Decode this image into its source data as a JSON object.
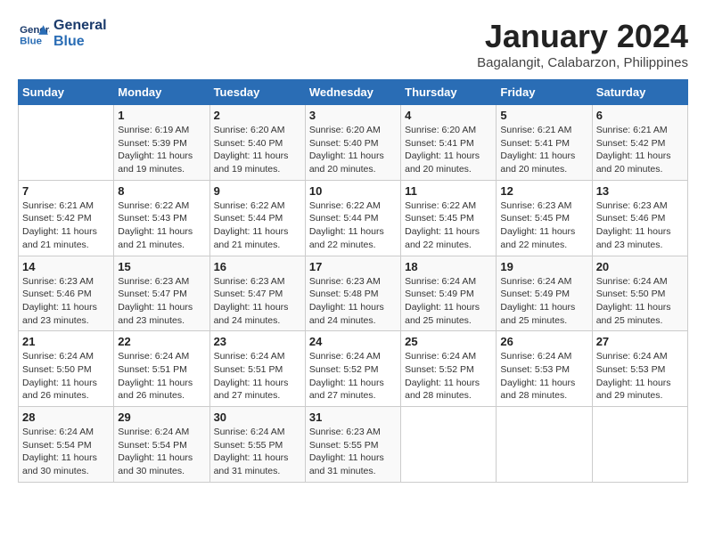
{
  "logo": {
    "line1": "General",
    "line2": "Blue"
  },
  "title": "January 2024",
  "subtitle": "Bagalangit, Calabarzon, Philippines",
  "header_days": [
    "Sunday",
    "Monday",
    "Tuesday",
    "Wednesday",
    "Thursday",
    "Friday",
    "Saturday"
  ],
  "weeks": [
    [
      {
        "day": "",
        "info": ""
      },
      {
        "day": "1",
        "info": "Sunrise: 6:19 AM\nSunset: 5:39 PM\nDaylight: 11 hours\nand 19 minutes."
      },
      {
        "day": "2",
        "info": "Sunrise: 6:20 AM\nSunset: 5:40 PM\nDaylight: 11 hours\nand 19 minutes."
      },
      {
        "day": "3",
        "info": "Sunrise: 6:20 AM\nSunset: 5:40 PM\nDaylight: 11 hours\nand 20 minutes."
      },
      {
        "day": "4",
        "info": "Sunrise: 6:20 AM\nSunset: 5:41 PM\nDaylight: 11 hours\nand 20 minutes."
      },
      {
        "day": "5",
        "info": "Sunrise: 6:21 AM\nSunset: 5:41 PM\nDaylight: 11 hours\nand 20 minutes."
      },
      {
        "day": "6",
        "info": "Sunrise: 6:21 AM\nSunset: 5:42 PM\nDaylight: 11 hours\nand 20 minutes."
      }
    ],
    [
      {
        "day": "7",
        "info": "Sunrise: 6:21 AM\nSunset: 5:42 PM\nDaylight: 11 hours\nand 21 minutes."
      },
      {
        "day": "8",
        "info": "Sunrise: 6:22 AM\nSunset: 5:43 PM\nDaylight: 11 hours\nand 21 minutes."
      },
      {
        "day": "9",
        "info": "Sunrise: 6:22 AM\nSunset: 5:44 PM\nDaylight: 11 hours\nand 21 minutes."
      },
      {
        "day": "10",
        "info": "Sunrise: 6:22 AM\nSunset: 5:44 PM\nDaylight: 11 hours\nand 22 minutes."
      },
      {
        "day": "11",
        "info": "Sunrise: 6:22 AM\nSunset: 5:45 PM\nDaylight: 11 hours\nand 22 minutes."
      },
      {
        "day": "12",
        "info": "Sunrise: 6:23 AM\nSunset: 5:45 PM\nDaylight: 11 hours\nand 22 minutes."
      },
      {
        "day": "13",
        "info": "Sunrise: 6:23 AM\nSunset: 5:46 PM\nDaylight: 11 hours\nand 23 minutes."
      }
    ],
    [
      {
        "day": "14",
        "info": "Sunrise: 6:23 AM\nSunset: 5:46 PM\nDaylight: 11 hours\nand 23 minutes."
      },
      {
        "day": "15",
        "info": "Sunrise: 6:23 AM\nSunset: 5:47 PM\nDaylight: 11 hours\nand 23 minutes."
      },
      {
        "day": "16",
        "info": "Sunrise: 6:23 AM\nSunset: 5:47 PM\nDaylight: 11 hours\nand 24 minutes."
      },
      {
        "day": "17",
        "info": "Sunrise: 6:23 AM\nSunset: 5:48 PM\nDaylight: 11 hours\nand 24 minutes."
      },
      {
        "day": "18",
        "info": "Sunrise: 6:24 AM\nSunset: 5:49 PM\nDaylight: 11 hours\nand 25 minutes."
      },
      {
        "day": "19",
        "info": "Sunrise: 6:24 AM\nSunset: 5:49 PM\nDaylight: 11 hours\nand 25 minutes."
      },
      {
        "day": "20",
        "info": "Sunrise: 6:24 AM\nSunset: 5:50 PM\nDaylight: 11 hours\nand 25 minutes."
      }
    ],
    [
      {
        "day": "21",
        "info": "Sunrise: 6:24 AM\nSunset: 5:50 PM\nDaylight: 11 hours\nand 26 minutes."
      },
      {
        "day": "22",
        "info": "Sunrise: 6:24 AM\nSunset: 5:51 PM\nDaylight: 11 hours\nand 26 minutes."
      },
      {
        "day": "23",
        "info": "Sunrise: 6:24 AM\nSunset: 5:51 PM\nDaylight: 11 hours\nand 27 minutes."
      },
      {
        "day": "24",
        "info": "Sunrise: 6:24 AM\nSunset: 5:52 PM\nDaylight: 11 hours\nand 27 minutes."
      },
      {
        "day": "25",
        "info": "Sunrise: 6:24 AM\nSunset: 5:52 PM\nDaylight: 11 hours\nand 28 minutes."
      },
      {
        "day": "26",
        "info": "Sunrise: 6:24 AM\nSunset: 5:53 PM\nDaylight: 11 hours\nand 28 minutes."
      },
      {
        "day": "27",
        "info": "Sunrise: 6:24 AM\nSunset: 5:53 PM\nDaylight: 11 hours\nand 29 minutes."
      }
    ],
    [
      {
        "day": "28",
        "info": "Sunrise: 6:24 AM\nSunset: 5:54 PM\nDaylight: 11 hours\nand 30 minutes."
      },
      {
        "day": "29",
        "info": "Sunrise: 6:24 AM\nSunset: 5:54 PM\nDaylight: 11 hours\nand 30 minutes."
      },
      {
        "day": "30",
        "info": "Sunrise: 6:24 AM\nSunset: 5:55 PM\nDaylight: 11 hours\nand 31 minutes."
      },
      {
        "day": "31",
        "info": "Sunrise: 6:23 AM\nSunset: 5:55 PM\nDaylight: 11 hours\nand 31 minutes."
      },
      {
        "day": "",
        "info": ""
      },
      {
        "day": "",
        "info": ""
      },
      {
        "day": "",
        "info": ""
      }
    ]
  ]
}
